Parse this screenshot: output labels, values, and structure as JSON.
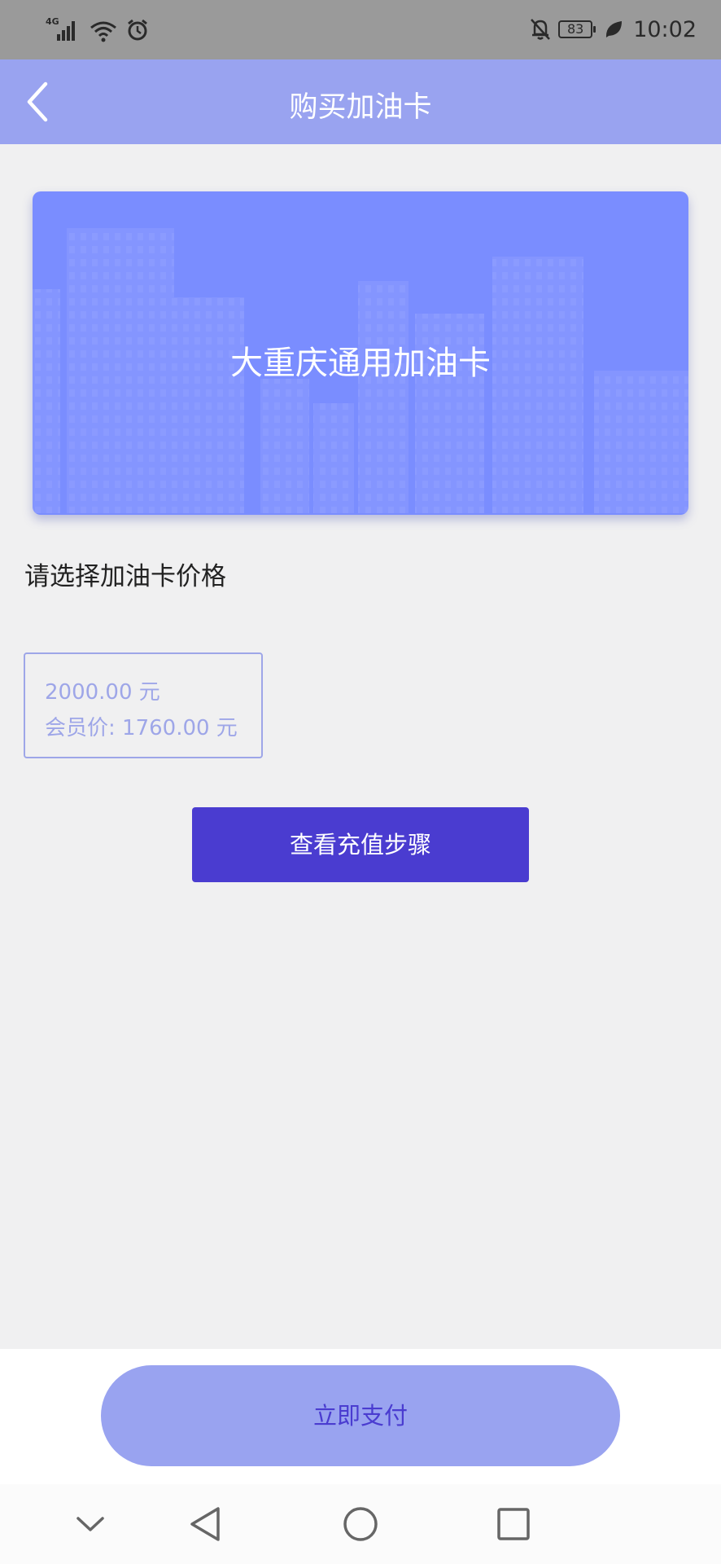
{
  "status_bar": {
    "network": "4G",
    "battery": "83",
    "time": "10:02"
  },
  "nav": {
    "title": "购买加油卡"
  },
  "card": {
    "title": "大重庆通用加油卡"
  },
  "section_label": "请选择加油卡价格",
  "price_options": [
    {
      "price": "2000.00 元",
      "member_price": "会员价: 1760.00 元"
    }
  ],
  "steps_button_label": "查看充值步骤",
  "pay_button_label": "立即支付",
  "icons": {
    "back": "chevron-left-icon",
    "signal": "signal-icon",
    "wifi": "wifi-icon",
    "alarm": "alarm-icon",
    "mute": "bell-off-icon",
    "leaf": "leaf-icon",
    "sys_down": "chevron-down-icon",
    "sys_back": "triangle-back-icon",
    "sys_home": "circle-home-icon",
    "sys_recent": "square-recent-icon"
  },
  "colors": {
    "header": "#99a3f0",
    "card": "#7a8dff",
    "primary_button": "#4a3cd0",
    "pay_button": "#99a3f0"
  }
}
